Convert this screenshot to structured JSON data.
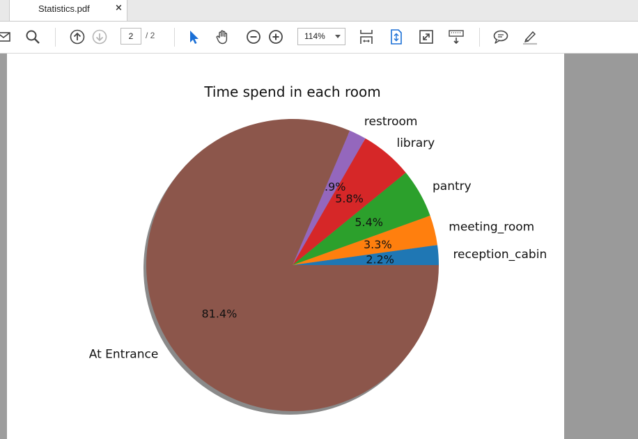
{
  "tab": {
    "title": "Statistics.pdf",
    "close": "×"
  },
  "toolbar": {
    "page_current": "2",
    "page_total": "/ 2",
    "zoom": "114%",
    "icons": [
      "mail-icon",
      "search-icon",
      "page-up-icon",
      "page-down-icon",
      "select-arrow-icon",
      "hand-icon",
      "zoom-out-icon",
      "zoom-in-icon",
      "scroll-mode-icon",
      "fit-page-icon",
      "fullscreen-icon",
      "keyboard-icon",
      "comment-icon",
      "highlight-pen-icon"
    ]
  },
  "chart_data": {
    "type": "pie",
    "title": "Time spend in each room",
    "start_angle_deg": 0,
    "direction": "counterclockwise",
    "shadow": true,
    "slices": [
      {
        "label": "reception_cabin",
        "value": 2.2,
        "pct_label": "2.2%",
        "color": "#1f77b4"
      },
      {
        "label": "meeting_room",
        "value": 3.3,
        "pct_label": "3.3%",
        "color": "#ff7f0e"
      },
      {
        "label": "pantry",
        "value": 5.4,
        "pct_label": "5.4%",
        "color": "#2ca02c"
      },
      {
        "label": "library",
        "value": 5.8,
        "pct_label": "5.8%",
        "color": "#d62728"
      },
      {
        "label": "restroom",
        "value": 1.9,
        "pct_label": "1.9%",
        "color": "#9467bd"
      },
      {
        "label": "At Entrance",
        "value": 81.4,
        "pct_label": "81.4%",
        "color": "#8c564b"
      }
    ]
  }
}
